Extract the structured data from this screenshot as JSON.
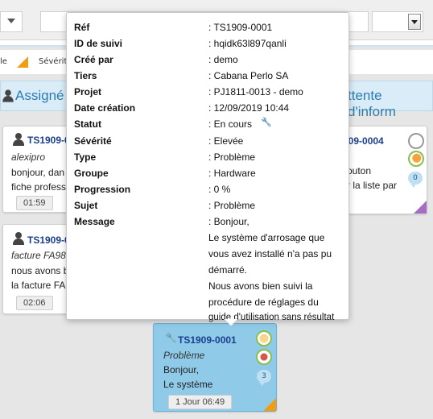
{
  "legend": {
    "left_label": "le",
    "severity_label": "Sévérité"
  },
  "columns": {
    "assigned": "Assigné",
    "waiting": "ttente d'inform"
  },
  "cards": [
    {
      "ref": "TS1909-0",
      "user": "alexipro",
      "line1": "bonjour, dan",
      "line2": "fiche profess",
      "time": "01:59"
    },
    {
      "ref": "TS1909-0",
      "user": "facture FA98",
      "line1": "nous avons b",
      "line2": "la facture FA",
      "time": "02:06"
    },
    {
      "ref": "909-0004",
      "line1": "outon",
      "line2": "r la liste par",
      "count": "0"
    },
    {
      "ref": "TS1909-0001",
      "user": "Problème",
      "line1": "Bonjour,",
      "line2": "Le système",
      "time": "1 Jour 06:49",
      "count": "3"
    }
  ],
  "tooltip": {
    "fields": [
      {
        "label": "Réf",
        "value": ": TS1909-0001"
      },
      {
        "label": "ID de suivi",
        "value": ": hqidk63l897qanli"
      },
      {
        "label": "Créé par",
        "value": ": demo"
      },
      {
        "label": "Tiers",
        "value": ": Cabana Perlo SA"
      },
      {
        "label": "Projet",
        "value": ": PJ1811-0013 - demo"
      },
      {
        "label": "Date création",
        "value": ": 12/09/2019 10:44"
      },
      {
        "label": "Statut",
        "value": ": En cours"
      },
      {
        "label": "Sévérité",
        "value": ": Elevée"
      },
      {
        "label": "Type",
        "value": ": Problème"
      },
      {
        "label": "Groupe",
        "value": ": Hardware"
      },
      {
        "label": "Progression",
        "value": ": 0 %"
      },
      {
        "label": "Sujet",
        "value": ": Problème"
      },
      {
        "label": "Message",
        "value": ": Bonjour,"
      }
    ],
    "message_lines": [
      "Le système d'arrosage que",
      "vous avez installé n'a pas pu",
      "démarré.",
      "Nous avons bien suivi la",
      "procédure de réglages du",
      "guide d'utilisation sans résultat"
    ]
  },
  "colors": {
    "accent": "#2c7cb0",
    "severity_high": "#f39c12",
    "card_active_bg": "#8fcbe9",
    "ref_text": "#1a3f8c"
  }
}
